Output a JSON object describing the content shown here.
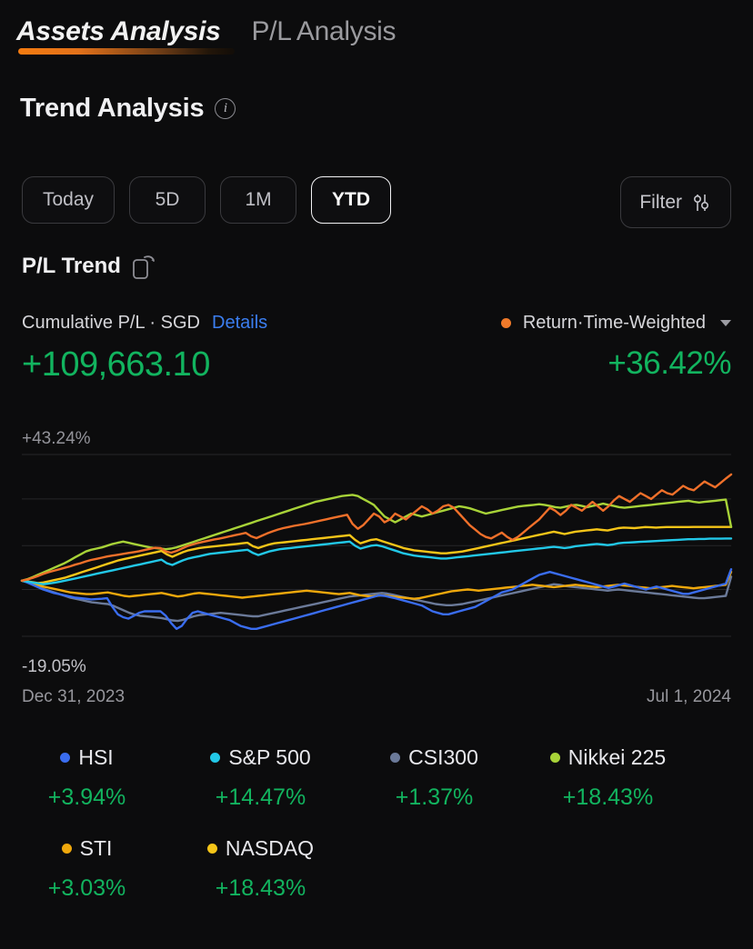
{
  "tabs": [
    {
      "label": "Assets Analysis",
      "active": true
    },
    {
      "label": "P/L Analysis",
      "active": false
    }
  ],
  "section": {
    "title": "Trend Analysis",
    "info_icon": "info-icon"
  },
  "periods": [
    {
      "label": "Today",
      "active": false
    },
    {
      "label": "5D",
      "active": false
    },
    {
      "label": "1M",
      "active": false
    },
    {
      "label": "YTD",
      "active": true
    }
  ],
  "filter": {
    "label": "Filter",
    "icon": "sliders-icon"
  },
  "pl_trend": {
    "title": "P/L Trend",
    "icon": "rotate-device-icon"
  },
  "summary": {
    "left_caption": "Cumulative P/L · SGD",
    "details_label": "Details",
    "left_value": "+109,663.10",
    "right_caption": "Return·Time-Weighted",
    "right_value": "+36.42%",
    "right_dot_color": "#f07a2a",
    "positive_color": "#12b45f",
    "link_color": "#3b7ef0"
  },
  "chart_data": {
    "type": "line",
    "title": "P/L Trend",
    "xlabel": "",
    "ylabel": "",
    "x_start": "Dec 31, 2023",
    "x_end": "Jul 1, 2024",
    "y_top_label": "+43.24%",
    "y_bottom_label": "-19.05%",
    "ylim": [
      -19.05,
      43.24
    ],
    "grid": true,
    "legend_position": "below",
    "series": [
      {
        "name": "Return·Time-Weighted",
        "color": "#f0702a",
        "final_value": 36.42,
        "values": [
          0,
          0.4,
          0.9,
          1.6,
          2.3,
          2.9,
          3.4,
          3.9,
          4.4,
          4.9,
          5.5,
          6.0,
          6.6,
          7.1,
          7.5,
          7.9,
          8.3,
          8.6,
          8.9,
          9.2,
          9.5,
          9.8,
          10.1,
          10.5,
          10.9,
          11.3,
          11.2,
          10.0,
          9.6,
          10.2,
          11.0,
          11.8,
          12.4,
          12.9,
          13.3,
          13.7,
          14.1,
          14.4,
          14.8,
          15.2,
          15.6,
          16.0,
          16.4,
          15.2,
          14.6,
          15.4,
          16.2,
          16.9,
          17.5,
          18.0,
          18.4,
          18.8,
          19.1,
          19.4,
          19.8,
          20.2,
          20.6,
          21.0,
          21.4,
          21.8,
          22.2,
          22.6,
          19.5,
          17.8,
          19.0,
          21.0,
          23.0,
          22.0,
          20.0,
          21.0,
          23.0,
          22.0,
          21.0,
          22.5,
          24.0,
          25.5,
          24.5,
          23.0,
          24.0,
          25.5,
          26.0,
          25.0,
          23.0,
          21.0,
          19.0,
          17.5,
          16.0,
          15.0,
          14.5,
          15.5,
          16.5,
          15.0,
          14.0,
          15.0,
          16.5,
          18.0,
          19.5,
          21.0,
          23.0,
          25.0,
          24.0,
          22.5,
          24.0,
          26.0,
          25.0,
          24.0,
          25.5,
          27.0,
          25.5,
          24.0,
          25.5,
          27.5,
          29.0,
          28.0,
          27.0,
          28.5,
          30.0,
          29.0,
          28.0,
          29.5,
          31.0,
          30.0,
          29.5,
          31.0,
          32.5,
          31.5,
          31.0,
          32.5,
          34.0,
          33.0,
          32.0,
          33.5,
          35.0,
          36.42
        ]
      },
      {
        "name": "HSI",
        "color": "#3a6df0",
        "final_value": 3.94,
        "values": [
          0,
          -0.6,
          -1.4,
          -2.2,
          -3.0,
          -3.6,
          -4.2,
          -4.6,
          -5.0,
          -5.4,
          -5.8,
          -6.0,
          -6.2,
          -6.4,
          -6.3,
          -6.2,
          -6.0,
          -9.0,
          -11.5,
          -12.5,
          -13.0,
          -12.0,
          -11.0,
          -10.5,
          -10.5,
          -10.5,
          -10.5,
          -12.0,
          -14.5,
          -16.5,
          -15.5,
          -13.0,
          -11.0,
          -10.5,
          -11.0,
          -11.5,
          -12.0,
          -12.5,
          -13.0,
          -13.5,
          -14.5,
          -15.5,
          -16.0,
          -16.5,
          -16.5,
          -16.0,
          -15.5,
          -15.0,
          -14.5,
          -14.0,
          -13.5,
          -13.0,
          -12.5,
          -12.0,
          -11.5,
          -11.0,
          -10.5,
          -10.0,
          -9.5,
          -9.0,
          -8.5,
          -8.0,
          -7.5,
          -7.0,
          -6.5,
          -6.0,
          -5.5,
          -5.0,
          -5.2,
          -5.6,
          -6.0,
          -6.5,
          -7.0,
          -7.5,
          -8.0,
          -8.5,
          -9.5,
          -10.5,
          -11.0,
          -11.5,
          -11.5,
          -11.0,
          -10.5,
          -10.0,
          -9.5,
          -9.0,
          -8.0,
          -7.0,
          -6.0,
          -5.0,
          -4.0,
          -3.5,
          -3.0,
          -2.0,
          -1.0,
          0.0,
          1.0,
          2.0,
          2.5,
          3.0,
          2.5,
          2.0,
          1.5,
          1.0,
          0.5,
          0.0,
          -0.5,
          -1.0,
          -1.5,
          -2.0,
          -2.5,
          -2.0,
          -1.5,
          -1.0,
          -1.5,
          -2.0,
          -2.5,
          -3.0,
          -2.5,
          -2.0,
          -2.5,
          -3.0,
          -3.5,
          -4.0,
          -4.5,
          -4.5,
          -4.0,
          -3.5,
          -3.0,
          -2.5,
          -2.0,
          -1.5,
          -1.0,
          3.94
        ]
      },
      {
        "name": "S&P 500",
        "color": "#22c8e8",
        "final_value": 14.47,
        "values": [
          0,
          -0.3,
          -0.6,
          -0.9,
          -1.2,
          -1.0,
          -0.7,
          -0.4,
          0.0,
          0.4,
          0.8,
          1.2,
          1.6,
          2.0,
          2.4,
          2.8,
          3.2,
          3.6,
          4.0,
          4.4,
          4.8,
          5.2,
          5.6,
          6.0,
          6.4,
          6.8,
          7.2,
          6.0,
          5.4,
          6.2,
          7.0,
          7.6,
          8.0,
          8.4,
          8.8,
          9.2,
          9.4,
          9.6,
          9.8,
          10.0,
          10.2,
          10.4,
          10.6,
          9.5,
          8.8,
          9.4,
          10.0,
          10.4,
          10.8,
          11.0,
          11.2,
          11.4,
          11.6,
          11.8,
          12.0,
          12.2,
          12.4,
          12.6,
          12.8,
          13.0,
          13.2,
          13.4,
          12.0,
          11.0,
          11.5,
          12.0,
          12.2,
          11.8,
          11.2,
          10.6,
          10.0,
          9.4,
          9.0,
          8.6,
          8.4,
          8.2,
          8.0,
          7.8,
          7.6,
          7.6,
          7.8,
          8.0,
          8.2,
          8.4,
          8.6,
          8.8,
          9.0,
          9.2,
          9.4,
          9.6,
          9.8,
          10.0,
          10.2,
          10.4,
          10.6,
          10.8,
          11.0,
          11.2,
          11.4,
          11.6,
          11.4,
          11.2,
          11.4,
          11.8,
          12.0,
          12.2,
          12.4,
          12.6,
          12.4,
          12.2,
          12.4,
          12.8,
          13.0,
          13.1,
          13.2,
          13.3,
          13.4,
          13.5,
          13.6,
          13.7,
          13.8,
          13.9,
          14.0,
          14.1,
          14.2,
          14.2,
          14.3,
          14.3,
          14.4,
          14.4,
          14.4,
          14.45,
          14.47
        ]
      },
      {
        "name": "CSI300",
        "color": "#6b7a99",
        "final_value": 1.37,
        "values": [
          0,
          -0.5,
          -1.2,
          -2.0,
          -2.8,
          -3.4,
          -4.0,
          -4.6,
          -5.2,
          -5.8,
          -6.2,
          -6.6,
          -7.0,
          -7.4,
          -7.6,
          -7.8,
          -8.0,
          -8.6,
          -9.4,
          -10.2,
          -11.0,
          -11.6,
          -12.0,
          -12.2,
          -12.4,
          -12.6,
          -12.8,
          -13.2,
          -13.6,
          -13.8,
          -13.4,
          -12.8,
          -12.2,
          -11.8,
          -11.6,
          -11.4,
          -11.2,
          -11.0,
          -11.2,
          -11.4,
          -11.6,
          -11.8,
          -12.0,
          -12.2,
          -12.2,
          -11.8,
          -11.4,
          -11.0,
          -10.6,
          -10.2,
          -9.8,
          -9.4,
          -9.0,
          -8.6,
          -8.2,
          -7.8,
          -7.4,
          -7.0,
          -6.6,
          -6.2,
          -5.8,
          -5.4,
          -5.2,
          -5.0,
          -4.8,
          -4.6,
          -4.4,
          -4.2,
          -4.4,
          -4.8,
          -5.2,
          -5.6,
          -6.0,
          -6.4,
          -6.8,
          -7.2,
          -7.6,
          -8.0,
          -8.2,
          -8.4,
          -8.4,
          -8.2,
          -8.0,
          -7.6,
          -7.2,
          -6.8,
          -6.4,
          -6.0,
          -5.6,
          -5.2,
          -4.8,
          -4.4,
          -4.0,
          -3.6,
          -3.2,
          -2.8,
          -2.4,
          -2.0,
          -1.6,
          -1.2,
          -1.4,
          -1.8,
          -2.0,
          -2.2,
          -2.4,
          -2.6,
          -2.8,
          -3.0,
          -3.2,
          -3.4,
          -3.2,
          -3.0,
          -3.2,
          -3.4,
          -3.6,
          -3.8,
          -4.0,
          -4.2,
          -4.4,
          -4.6,
          -4.8,
          -5.0,
          -5.2,
          -5.4,
          -5.6,
          -5.8,
          -6.0,
          -6.0,
          -5.8,
          -5.6,
          -5.4,
          -5.2,
          1.37
        ]
      },
      {
        "name": "Nikkei 225",
        "color": "#a8d338",
        "final_value": 18.43,
        "values": [
          0,
          0.5,
          1.2,
          2.0,
          2.8,
          3.6,
          4.4,
          5.2,
          6.0,
          7.0,
          8.0,
          9.0,
          10.0,
          10.6,
          11.0,
          11.4,
          12.0,
          12.6,
          13.0,
          13.4,
          13.0,
          12.6,
          12.2,
          11.8,
          11.4,
          11.2,
          11.0,
          10.8,
          11.0,
          11.4,
          12.0,
          12.6,
          13.2,
          13.8,
          14.4,
          15.0,
          15.6,
          16.2,
          16.8,
          17.4,
          18.0,
          18.6,
          19.2,
          19.8,
          20.4,
          21.0,
          21.6,
          22.2,
          22.8,
          23.4,
          24.0,
          24.6,
          25.2,
          25.8,
          26.4,
          27.0,
          27.4,
          27.8,
          28.2,
          28.6,
          29.0,
          29.2,
          29.4,
          29.0,
          28.0,
          27.0,
          26.0,
          24.0,
          22.0,
          21.0,
          20.0,
          21.0,
          22.0,
          23.0,
          22.5,
          22.0,
          22.5,
          23.0,
          23.5,
          24.0,
          24.5,
          25.0,
          25.5,
          25.2,
          24.8,
          24.2,
          23.6,
          23.0,
          23.4,
          23.8,
          24.2,
          24.6,
          25.0,
          25.4,
          25.6,
          25.8,
          26.0,
          26.2,
          26.0,
          25.6,
          25.2,
          25.0,
          25.4,
          25.8,
          26.0,
          25.6,
          25.2,
          25.6,
          26.0,
          26.4,
          26.0,
          25.6,
          25.2,
          25.0,
          25.2,
          25.4,
          25.6,
          25.8,
          26.0,
          26.2,
          26.4,
          26.6,
          26.8,
          27.0,
          27.2,
          27.4,
          27.0,
          26.8,
          27.0,
          27.2,
          27.4,
          27.6,
          27.8,
          18.43
        ]
      },
      {
        "name": "STI",
        "color": "#efa80c",
        "final_value": 3.03,
        "values": [
          0,
          -0.4,
          -0.9,
          -1.5,
          -2.0,
          -2.4,
          -2.8,
          -3.2,
          -3.6,
          -4.0,
          -4.2,
          -4.4,
          -4.6,
          -4.6,
          -4.4,
          -4.2,
          -4.0,
          -4.4,
          -4.8,
          -5.2,
          -5.4,
          -5.2,
          -5.0,
          -4.8,
          -4.6,
          -4.4,
          -4.2,
          -4.6,
          -5.0,
          -5.4,
          -5.2,
          -4.8,
          -4.4,
          -4.2,
          -4.4,
          -4.6,
          -4.8,
          -5.0,
          -5.2,
          -5.4,
          -5.6,
          -5.8,
          -5.6,
          -5.4,
          -5.2,
          -5.0,
          -4.8,
          -4.6,
          -4.4,
          -4.2,
          -4.0,
          -3.8,
          -3.6,
          -3.4,
          -3.6,
          -3.8,
          -4.0,
          -4.2,
          -4.4,
          -4.6,
          -4.4,
          -4.2,
          -4.6,
          -5.0,
          -5.2,
          -5.4,
          -5.2,
          -5.0,
          -5.2,
          -5.4,
          -5.6,
          -5.8,
          -6.0,
          -6.2,
          -6.0,
          -5.6,
          -5.2,
          -4.8,
          -4.4,
          -4.0,
          -3.6,
          -3.4,
          -3.2,
          -3.0,
          -3.2,
          -3.4,
          -3.2,
          -3.0,
          -2.8,
          -2.6,
          -2.4,
          -2.2,
          -2.0,
          -1.8,
          -1.6,
          -1.4,
          -1.6,
          -1.8,
          -2.0,
          -2.2,
          -2.0,
          -1.8,
          -1.6,
          -1.4,
          -1.6,
          -1.8,
          -2.0,
          -2.2,
          -2.0,
          -1.8,
          -1.6,
          -1.4,
          -1.6,
          -1.8,
          -2.0,
          -2.2,
          -2.4,
          -2.6,
          -2.4,
          -2.2,
          -2.0,
          -1.8,
          -2.0,
          -2.2,
          -2.4,
          -2.6,
          -2.4,
          -2.2,
          -2.0,
          -1.8,
          -1.6,
          -1.4,
          3.03
        ]
      },
      {
        "name": "NASDAQ",
        "color": "#f5c518",
        "final_value": 18.43,
        "values": [
          0,
          -0.2,
          -0.5,
          -0.8,
          -0.6,
          -0.2,
          0.2,
          0.6,
          1.0,
          1.6,
          2.2,
          2.8,
          3.4,
          4.0,
          4.6,
          5.2,
          5.8,
          6.4,
          7.0,
          7.4,
          7.8,
          8.2,
          8.6,
          9.0,
          9.4,
          9.8,
          10.2,
          9.0,
          8.2,
          9.0,
          9.8,
          10.4,
          10.8,
          11.2,
          11.4,
          11.6,
          11.8,
          12.0,
          12.2,
          12.4,
          12.6,
          12.8,
          13.0,
          11.8,
          11.2,
          11.8,
          12.4,
          12.8,
          13.0,
          13.2,
          13.4,
          13.6,
          13.8,
          14.0,
          14.2,
          14.4,
          14.6,
          14.8,
          15.0,
          15.2,
          15.4,
          15.6,
          14.0,
          12.8,
          13.4,
          14.0,
          14.2,
          13.6,
          13.0,
          12.4,
          11.8,
          11.2,
          10.8,
          10.4,
          10.2,
          10.0,
          9.8,
          9.6,
          9.4,
          9.4,
          9.6,
          9.8,
          10.0,
          10.4,
          10.8,
          11.2,
          11.6,
          12.0,
          12.4,
          12.8,
          13.2,
          13.6,
          14.0,
          14.4,
          14.8,
          15.2,
          15.6,
          16.0,
          16.4,
          16.8,
          16.4,
          16.0,
          16.4,
          16.8,
          17.0,
          17.2,
          17.4,
          17.6,
          17.4,
          17.2,
          17.6,
          18.0,
          18.2,
          18.1,
          18.0,
          18.2,
          18.4,
          18.3,
          18.2,
          18.3,
          18.4,
          18.4,
          18.4,
          18.4,
          18.4,
          18.43,
          18.43,
          18.43,
          18.43,
          18.43,
          18.43,
          18.43,
          18.43
        ]
      }
    ]
  },
  "legend": [
    [
      {
        "name": "HSI",
        "pct": "+3.94%",
        "color": "#3a6df0"
      },
      {
        "name": "S&P 500",
        "pct": "+14.47%",
        "color": "#22c8e8"
      },
      {
        "name": "CSI300",
        "pct": "+1.37%",
        "color": "#6b7a99"
      },
      {
        "name": "Nikkei 225",
        "pct": "+18.43%",
        "color": "#a8d338"
      }
    ],
    [
      {
        "name": "STI",
        "pct": "+3.03%",
        "color": "#efa80c"
      },
      {
        "name": "NASDAQ",
        "pct": "+18.43%",
        "color": "#f5c518"
      }
    ]
  ]
}
